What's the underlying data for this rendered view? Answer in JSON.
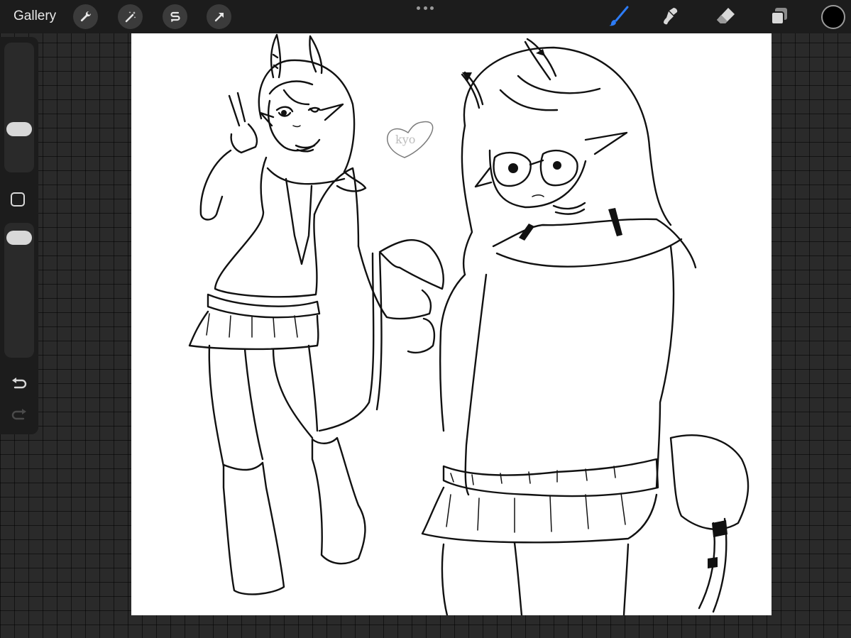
{
  "toolbar": {
    "gallery_label": "Gallery",
    "left_tools": [
      "wrench-icon",
      "magic-wand-icon",
      "selection-icon",
      "transform-arrow-icon"
    ],
    "right_tools": [
      "brush-icon",
      "smudge-icon",
      "eraser-icon",
      "layers-icon"
    ],
    "active_tool": "brush",
    "active_tool_color": "#2d7cf6",
    "current_color": "#000000"
  },
  "sidebar": {
    "brush_size_level": 0.45,
    "opacity_level": 0.9,
    "icons": [
      "modify-button",
      "undo-icon",
      "redo-icon"
    ]
  },
  "canvas": {
    "background": "#ffffff",
    "signature": "kyo"
  }
}
